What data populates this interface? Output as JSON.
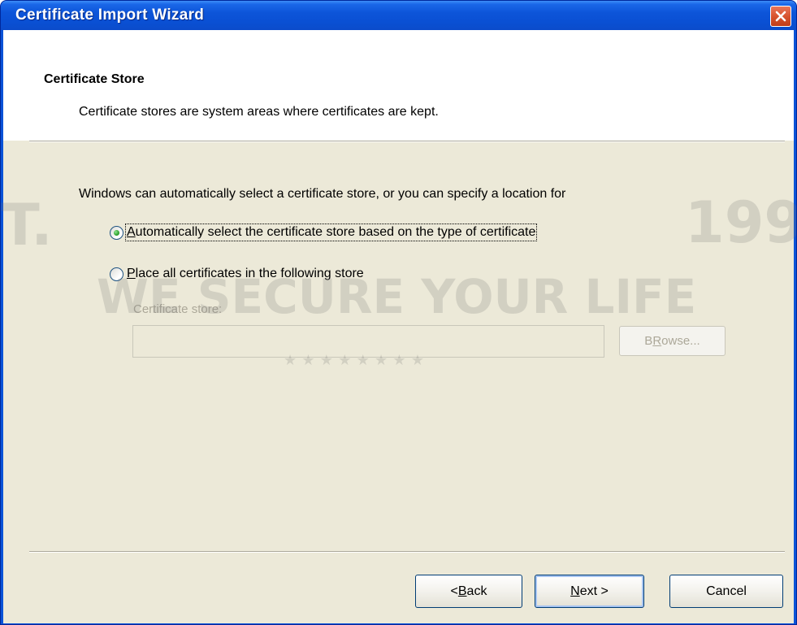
{
  "window": {
    "title": "Certificate Import Wizard"
  },
  "header": {
    "title": "Certificate Store",
    "subtitle": "Certificate stores are system areas where certificates are kept."
  },
  "body": {
    "intro": "Windows can automatically select a certificate store, or you can specify a location for",
    "options": [
      {
        "label_mnemonic": "A",
        "label_rest": "utomatically select the certificate store based on the type of certificate",
        "checked": true
      },
      {
        "label_mnemonic": "P",
        "label_rest": "lace all certificates in the following store",
        "checked": false
      }
    ],
    "store_label": "Certificate store:",
    "store_value": "",
    "browse_mnemonic": "R",
    "browse_prefix": "B",
    "browse_rest": "owse..."
  },
  "footer": {
    "back_prefix": "< ",
    "back_mnemonic": "B",
    "back_rest": "ack",
    "next_mnemonic": "N",
    "next_rest": "ext >",
    "cancel": "Cancel"
  },
  "watermark": {
    "line1": "WE SECURE YOUR LIFE",
    "line2": "★ ★ ★ ★ ★ ★ ★ ★",
    "left_letter": "T.",
    "right_digits": "199"
  },
  "colors": {
    "titlebar": "#0a53d8",
    "dialog_bg": "#ece9d8",
    "radio_dot": "#2fa32f",
    "close_button": "#d8542f"
  }
}
